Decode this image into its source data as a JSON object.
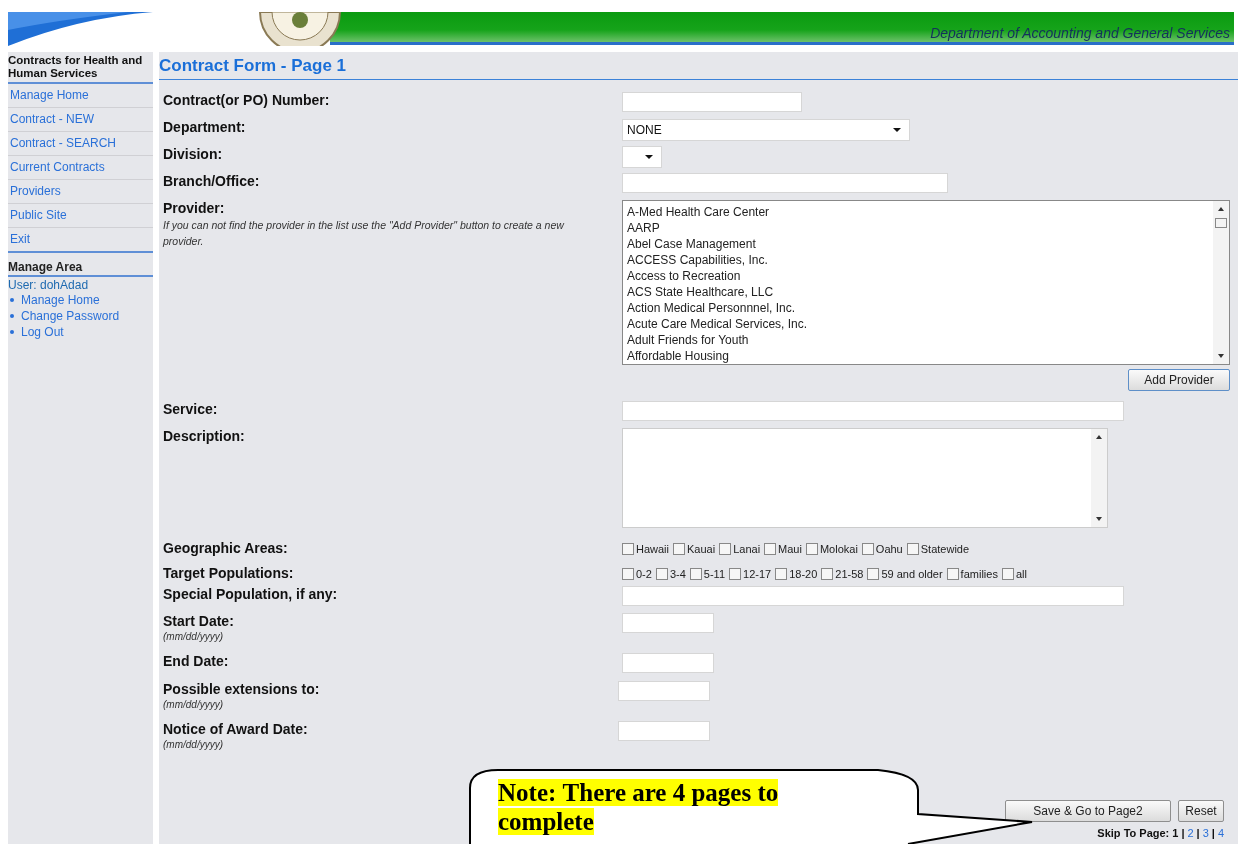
{
  "header": {
    "subtitle": "Department of Accounting and General Services"
  },
  "sidebar": {
    "title": "Contracts for Health and Human Services",
    "items": [
      {
        "label": "Manage Home"
      },
      {
        "label": "Contract - NEW"
      },
      {
        "label": "Contract - SEARCH"
      },
      {
        "label": "Current Contracts"
      },
      {
        "label": "Providers"
      },
      {
        "label": "Public Site"
      },
      {
        "label": "Exit"
      }
    ],
    "manage_area": {
      "title": "Manage Area",
      "user": "User: dohAdad",
      "links": [
        "Manage Home",
        "Change Password",
        "Log Out"
      ]
    }
  },
  "form": {
    "title": "Contract Form - Page 1",
    "fields": [
      {
        "kind": "text",
        "label": "Contract(or PO) Number:"
      },
      {
        "kind": "select",
        "label": "Department:",
        "value": "NONE"
      },
      {
        "kind": "select",
        "label": "Division:"
      },
      {
        "kind": "text",
        "label": "Branch/Office:"
      },
      {
        "kind": "listbox",
        "label": "Provider:",
        "hint": "If you can not find the provider in the list use the \"Add Provider\" button to create a new provider.",
        "options": [
          "A-Med Health Care Center",
          "AARP",
          "Abel Case Management",
          "ACCESS Capabilities, Inc.",
          "Access to Recreation",
          "ACS State Healthcare, LLC",
          "Action Medical Personnnel, Inc.",
          "Acute Care Medical Services, Inc.",
          "Adult Friends for Youth",
          "Affordable Housing"
        ],
        "button": "Add Provider"
      },
      {
        "kind": "text",
        "label": "Service:"
      },
      {
        "kind": "textarea",
        "label": "Description:"
      },
      {
        "kind": "checkboxes",
        "label": "Geographic Areas:",
        "options": [
          {
            "label": "Hawaii",
            "checked": false
          },
          {
            "label": "Kauai",
            "checked": false
          },
          {
            "label": "Lanai",
            "checked": false
          },
          {
            "label": "Maui",
            "checked": false
          },
          {
            "label": "Molokai",
            "checked": false
          },
          {
            "label": "Oahu",
            "checked": false
          },
          {
            "label": "Statewide",
            "checked": false
          }
        ]
      },
      {
        "kind": "checkboxes",
        "label": "Target Populations:",
        "options": [
          {
            "label": "0-2",
            "checked": false
          },
          {
            "label": "3-4",
            "checked": false
          },
          {
            "label": "5-11",
            "checked": false
          },
          {
            "label": "12-17",
            "checked": false
          },
          {
            "label": "18-20",
            "checked": false
          },
          {
            "label": "21-58",
            "checked": false
          },
          {
            "label": "59 and older",
            "checked": false
          },
          {
            "label": "families",
            "checked": false
          },
          {
            "label": "all",
            "checked": false
          }
        ]
      },
      {
        "kind": "text",
        "label": "Special Population, if any:"
      },
      {
        "kind": "date",
        "label": "Start Date:",
        "hint": "(mm/dd/yyyy)"
      },
      {
        "kind": "date",
        "label": "End Date:"
      },
      {
        "kind": "date",
        "label": "Possible extensions to:",
        "hint": "(mm/dd/yyyy)"
      },
      {
        "kind": "date",
        "label": "Notice of Award Date:",
        "hint": "(mm/dd/yyyy)"
      }
    ],
    "buttons": [
      "Save & Go to Page2",
      "Reset"
    ],
    "skip_to_page": {
      "label": "Skip To Page:",
      "pages": [
        {
          "label": "1",
          "selected": true,
          "separator": "|"
        },
        {
          "label": "2",
          "selected": false,
          "separator": "|"
        },
        {
          "label": "3",
          "selected": false,
          "separator": "|"
        },
        {
          "label": "4",
          "selected": false
        }
      ]
    }
  },
  "callout": {
    "text": "**Note**:  **There are 4 pages to complete**"
  }
}
